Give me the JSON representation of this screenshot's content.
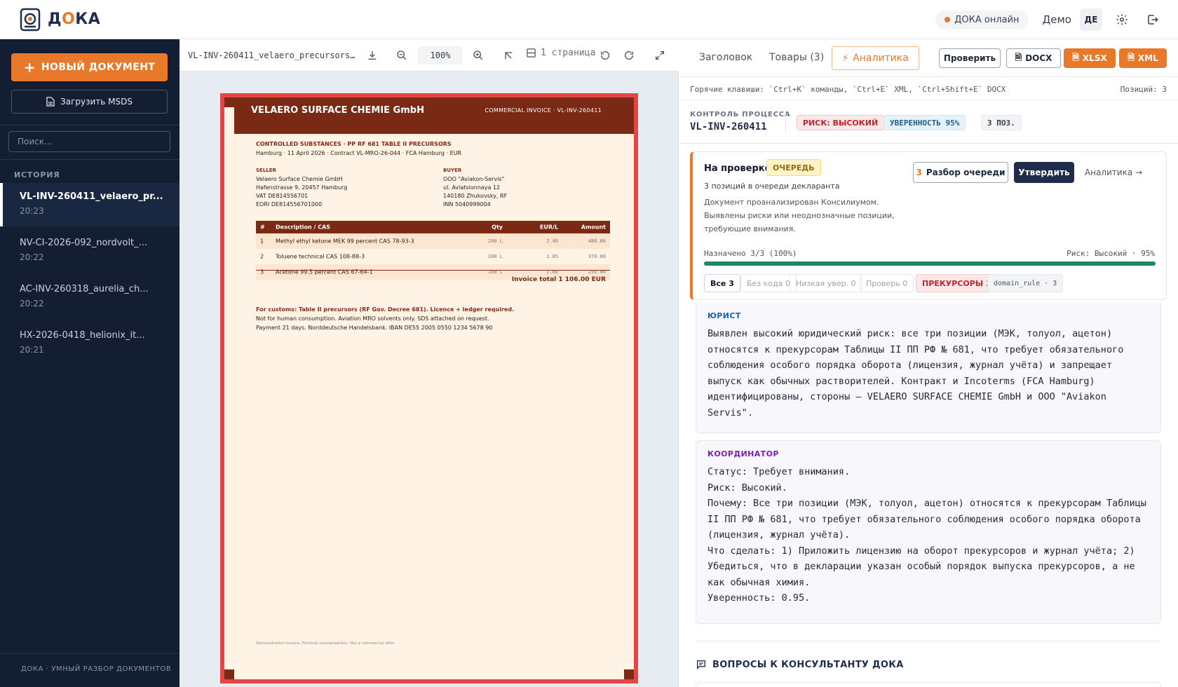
{
  "app": {
    "logo_text_pre": "Д",
    "logo_text_o": "О",
    "logo_text_post": "КА",
    "online_label": "ДОКА онлайн",
    "demo_label": "Демо",
    "lang": "ДЕ"
  },
  "sidebar": {
    "new_doc": "НОВЫЙ ДОКУМЕНТ",
    "upload_msds": "Загрузить MSDS",
    "search_placeholder": "Поиск...",
    "history_label": "ИСТОРИЯ",
    "history": [
      {
        "name": "VL-INV-260411_velaero_pr...",
        "time": "20:23",
        "active": true
      },
      {
        "name": "NV-CI-2026-092_nordvolt_...",
        "time": "20:22"
      },
      {
        "name": "AC-INV-260318_aurelia_ch...",
        "time": "20:22"
      },
      {
        "name": "HX-2026-0418_helionix_it...",
        "time": "20:21"
      }
    ],
    "footer": "ДОКА · УМНЫЙ РАЗБОР ДОКУМЕНТОВ"
  },
  "viewer": {
    "file_name": "VL-INV-260411_velaero_precursors...",
    "zoom": "100%",
    "pages": "1 страница",
    "doc": {
      "company": "VELAERO SURFACE CHEMIE GmbH",
      "header_right": "COMMERCIAL INVOICE · VL-INV-260411",
      "controlled": "CONTROLLED SUBSTANCES · PP RF 681 TABLE II PRECURSORS",
      "meta": "Hamburg · 11 April 2026 · Contract VL-MRO-26-044 · FCA Hamburg · EUR",
      "seller_label": "SELLER",
      "seller": [
        "Velaero Surface Chemie GmbH",
        "Hafenstrasse 9, 20457 Hamburg",
        "VAT DE814556701",
        "EORI DE814556701000"
      ],
      "buyer_label": "BUYER",
      "buyer": [
        "OOO \"Aviakon-Servis\"",
        "ul. Aviatsionnaya 12",
        "140180 Zhukovsky, RF",
        "INN 5040999004"
      ],
      "table_headers": [
        "#",
        "Description / CAS",
        "Qty",
        "EUR/L",
        "Amount"
      ],
      "rows": [
        {
          "n": "1",
          "desc": "Methyl ethyl ketone MEK 99 percent CAS 78-93-3",
          "qty": "200 L",
          "price": "2.40",
          "amount": "480.00"
        },
        {
          "n": "2",
          "desc": "Toluene technical CAS 108-88-3",
          "qty": "200 L",
          "price": "1.85",
          "amount": "370.00"
        },
        {
          "n": "3",
          "desc": "Acetone 99.5 percent CAS 67-64-1",
          "qty": "160 L",
          "price": "1.60",
          "amount": "256.00"
        }
      ],
      "total": "Invoice total   1 106.00 EUR",
      "note_red": "For customs: Table II precursors (RF Gov. Decree 681). Licence + ledger required.",
      "note1": "Not for human consumption. Aviation MRO solvents only. SDS attached on request.",
      "note2": "Payment 21 days. Norddeutsche Handelsbank. IBAN DE55 2005 0550 1234 5678 90",
      "footer": "Demonstration invoice. Fictional counterparties. Not a commercial offer."
    }
  },
  "panel": {
    "tabs": [
      "Заголовок",
      "Товары (3)",
      "Аналитика"
    ],
    "actions": {
      "check": "Проверить",
      "docx": "DOCX",
      "xlsx": "XLSX",
      "xml": "XML"
    },
    "hotkeys": "Горячие клавиши: `Ctrl+K` команды, `Ctrl+E` XML, `Ctrl+Shift+E` DOCX",
    "positions": "Позиций: 3",
    "control_label": "КОНТРОЛЬ ПРОЦЕССА",
    "control_id": "VL-INV-260411",
    "badges": {
      "risk": "РИСК: ВЫСОКИЙ",
      "confidence": "УВЕРЕННОСТЬ 95%",
      "count": "3 ПОЗ."
    },
    "review": {
      "title": "На проверке",
      "queue": "ОЧЕРЕДЬ",
      "subtitle": "3 позиций в очереди декларанта",
      "desc": "Документ проанализирован Консилиумом. Выявлены риски или неоднозначные позиции, требующие внимания.",
      "queue_btn_count": "3",
      "queue_btn": "Разбор очереди",
      "approve": "Утвердить",
      "analytics_link": "Аналитика →",
      "progress_label": "Назначено 3/3 (100%)",
      "progress_value": 1.0,
      "progress_risk": "Риск: Высокий · 95%",
      "chips": [
        "Все 3",
        "Без кода 0",
        "Низкая увер. 0",
        "Проверь 0",
        "ПРЕКУРСОРЫ 3",
        "domain_rule · 3"
      ]
    },
    "lawyer": {
      "role": "ЮРИСТ",
      "text": "Выявлен высокий юридический риск: все три позиции (МЭК, толуол, ацетон) относятся к прекурсорам Таблицы II ПП РФ № 681, что требует обязательного соблюдения особого порядка оборота (лицензия, журнал учёта) и запрещает выпуск как обычных растворителей. Контракт и Incoterms (FCA Hamburg) идентифицированы, стороны — VELAERO SURFACE CHEMIE GmbH и ООО \"Aviakon Servis\"."
    },
    "coordinator": {
      "role": "КООРДИНАТОР",
      "text": "Статус: Требует внимания.\nРиск: Высокий.\nПочему: Все три позиции (МЭК, толуол, ацетон) относятся к прекурсорам Таблицы II ПП РФ № 681, что требует обязательного соблюдения особого порядка оборота (лицензия, журнал учёта).\nЧто сделать: 1) Приложить лицензию на оборот прекурсоров и журнал учёта; 2) Убедиться, что в декларации указан особый порядок выпуска прекурсоров, а не как обычная химия.\nУверенность: 0.95."
    },
    "consult_title": "ВОПРОСЫ К КОНСУЛЬТАНТУ ДОКА"
  },
  "colors": {
    "accent": "#e8792b",
    "sidebar": "#141e33",
    "risk": "#c0262d",
    "progress": "#168a63"
  }
}
